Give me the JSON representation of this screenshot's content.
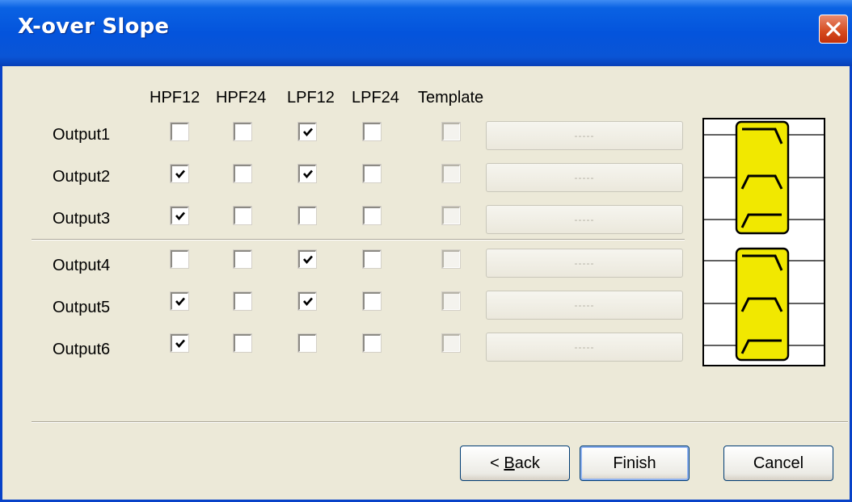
{
  "window": {
    "title": "X-over Slope"
  },
  "columns": [
    "HPF12",
    "HPF24",
    "LPF12",
    "LPF24",
    "Template"
  ],
  "rows": [
    {
      "label": "Output1",
      "checks": [
        false,
        false,
        true,
        false,
        false
      ],
      "template_label": "-----"
    },
    {
      "label": "Output2",
      "checks": [
        true,
        false,
        true,
        false,
        false
      ],
      "template_label": "-----"
    },
    {
      "label": "Output3",
      "checks": [
        true,
        false,
        false,
        false,
        false
      ],
      "template_label": "-----"
    },
    {
      "label": "Output4",
      "checks": [
        false,
        false,
        true,
        false,
        false
      ],
      "template_label": "-----"
    },
    {
      "label": "Output5",
      "checks": [
        true,
        false,
        true,
        false,
        false
      ],
      "template_label": "-----"
    },
    {
      "label": "Output6",
      "checks": [
        true,
        false,
        false,
        false,
        false
      ],
      "template_label": "-----"
    }
  ],
  "buttons": {
    "back_prefix": "< ",
    "back_mnemonic": "B",
    "back_rest": "ack",
    "finish": "Finish",
    "cancel": "Cancel"
  },
  "colors": {
    "title_bar": "#0454dc",
    "dialog_bg": "#ece9d8",
    "filter_yellow": "#f1e800",
    "close_red": "#d54a1d"
  },
  "diagram": {
    "icons": [
      "lowpass-slope-icon",
      "bandpass-slope-icon",
      "highpass-slope-icon"
    ]
  }
}
